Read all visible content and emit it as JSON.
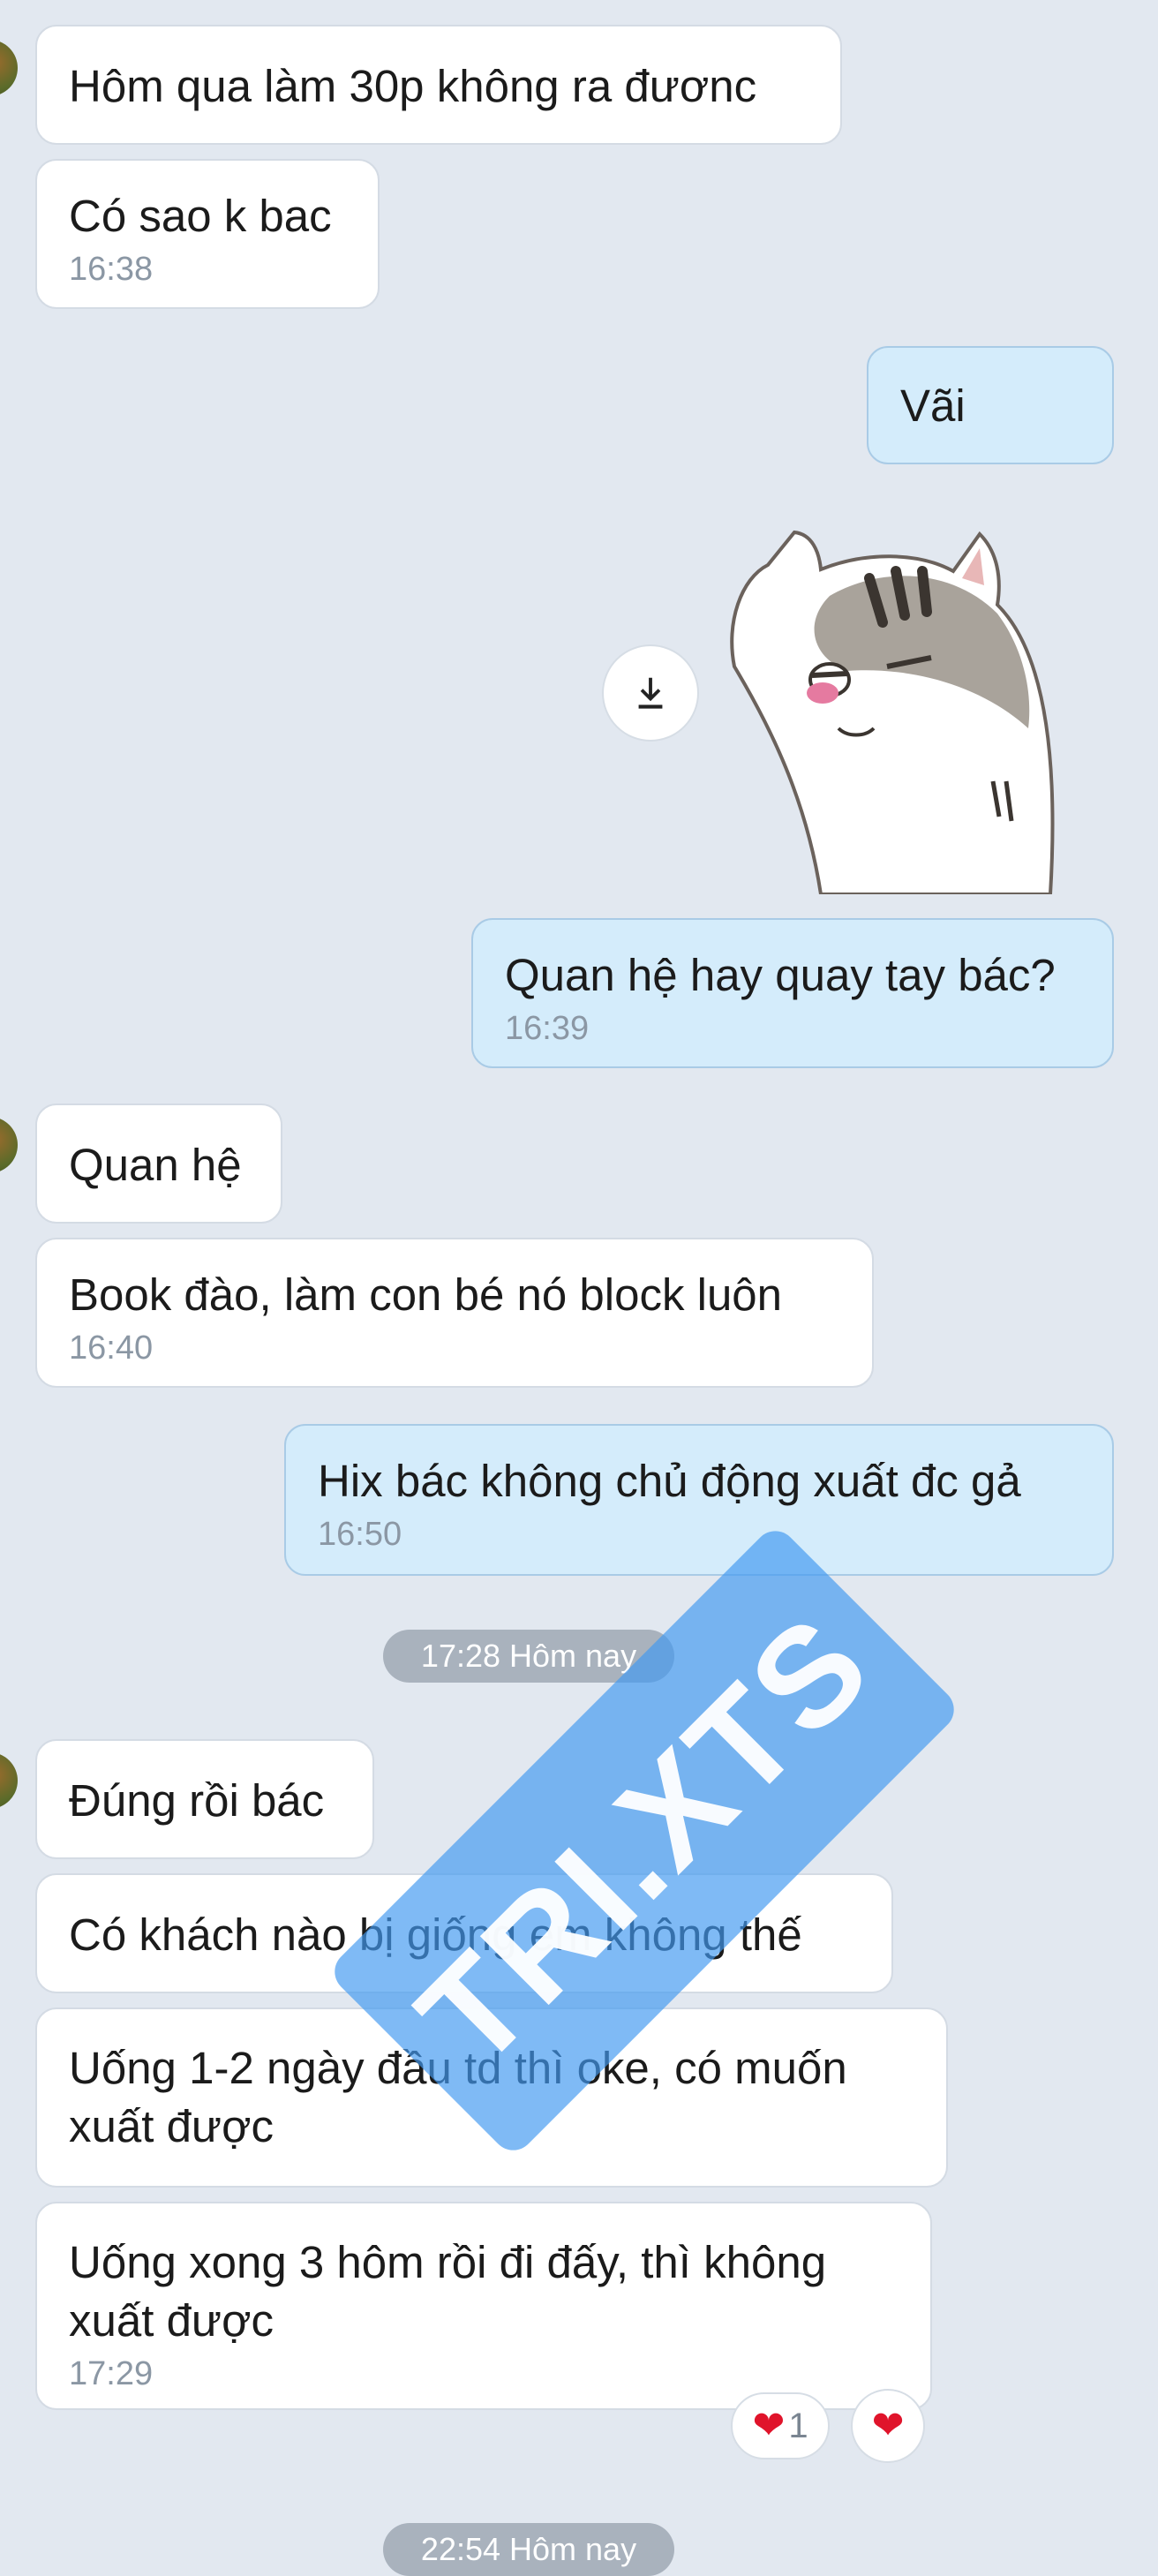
{
  "messages": [
    {
      "text": "Hôm qua làm 30p không ra đươnc"
    },
    {
      "text": "Có sao k bac",
      "time": "16:38"
    },
    {
      "text": "Vãi"
    },
    {
      "text": "Quan hệ hay quay tay bác?",
      "time": "16:39"
    },
    {
      "text": "Quan hệ"
    },
    {
      "text": "Book đào, làm con bé nó block luôn",
      "time": "16:40"
    },
    {
      "text": "Hix bác không chủ động xuất đc gả",
      "time": "16:50"
    },
    {
      "text": "Đúng rồi bác"
    },
    {
      "text": "Có khách nào bị giống em không thế"
    },
    {
      "text": "Uống 1-2 ngày đầu td thì oke, có muốn xuất được"
    },
    {
      "text": "Uống xong 3 hôm rồi đi đấy, thì không xuất được",
      "time": "17:29"
    }
  ],
  "separators": [
    "17:28 Hôm nay",
    "22:54 Hôm nay"
  ],
  "sticker": {
    "icon": "cat-sticker",
    "download_icon": "download-icon"
  },
  "reactions": [
    {
      "icon": "heart-icon",
      "count": "1"
    },
    {
      "icon": "heart-icon"
    }
  ],
  "watermark": "TRI.XTS",
  "colors": {
    "background": "#e2e8f0",
    "incoming_bubble": "#ffffff",
    "outgoing_bubble": "#d4ecfb",
    "timestamp": "#8b97a4",
    "separator": "#a9b2bd",
    "heart": "#e0142b",
    "watermark": "#4299f0"
  }
}
